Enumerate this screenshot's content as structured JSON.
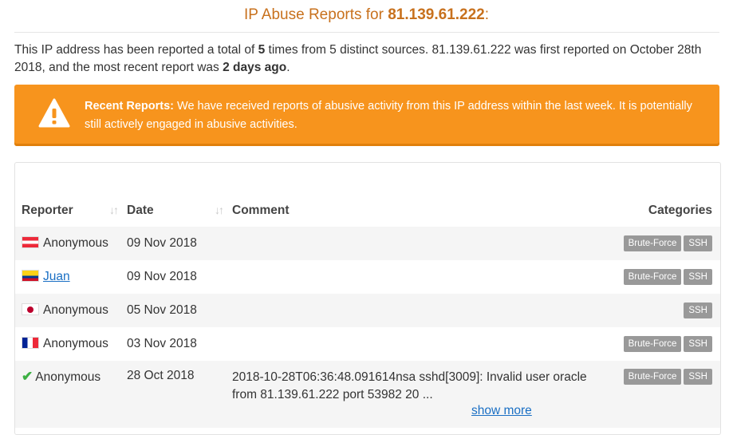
{
  "header": {
    "title_prefix": "IP Abuse Reports for",
    "ip": "81.139.61.222",
    "title_suffix": ":"
  },
  "summary": {
    "part1": "This IP address has been reported a total of ",
    "count": "5",
    "part2": " times from 5 distinct sources. 81.139.61.222 was first reported on October 28th 2018, and the most recent report was ",
    "recent": "2 days ago",
    "part3": "."
  },
  "alert": {
    "heading": "Recent Reports:",
    "text": " We have received reports of abusive activity from this IP address within the last week. It is potentially still actively engaged in abusive activities.",
    "icon": "warning-triangle-icon",
    "color": "#f7941d"
  },
  "table": {
    "headers": {
      "reporter": "Reporter",
      "date": "Date",
      "comment": "Comment",
      "categories": "Categories"
    },
    "sort_glyph": "↓↑",
    "rows": [
      {
        "flag": "austria",
        "reporter": "Anonymous",
        "date": "09 Nov 2018",
        "comment": "",
        "cat1": "Brute-Force",
        "cat2": "SSH"
      },
      {
        "flag": "colombia",
        "reporter": "Juan",
        "date": "09 Nov 2018",
        "comment": "",
        "cat1": "Brute-Force",
        "cat2": "SSH"
      },
      {
        "flag": "japan",
        "reporter": "Anonymous",
        "date": "05 Nov 2018",
        "comment": "",
        "cat2": "SSH"
      },
      {
        "flag": "france",
        "reporter": "Anonymous",
        "date": "03 Nov 2018",
        "comment": "",
        "cat1": "Brute-Force",
        "cat2": "SSH"
      },
      {
        "flag": "verified-check",
        "reporter": "Anonymous",
        "date": "28 Oct 2018",
        "comment": "2018-10-28T06:36:48.091614nsa sshd[3009]: Invalid user oracle from 81.139.61.222 port 53982 20 ...",
        "cat1": "Brute-Force",
        "cat2": "SSH",
        "show_more": "show more"
      }
    ]
  },
  "colors": {
    "title": "#c8711d",
    "link": "#1a6fc4",
    "badge": "#999999",
    "check": "#3cb043"
  }
}
